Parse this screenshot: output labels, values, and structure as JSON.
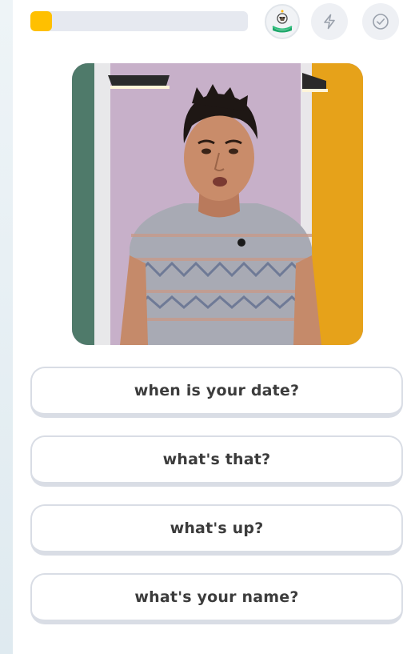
{
  "header": {
    "progress_percent": 10,
    "progress_color": "#ffc000",
    "avatar_icon": "mascot-avatar-icon",
    "bolt_icon": "lightning-bolt-icon",
    "check_icon": "check-circle-icon"
  },
  "video": {
    "content": "person speaking video clip"
  },
  "options": [
    {
      "label": "when is your date?"
    },
    {
      "label": "what's that?"
    },
    {
      "label": "what's up?"
    },
    {
      "label": "what's your name?"
    }
  ]
}
